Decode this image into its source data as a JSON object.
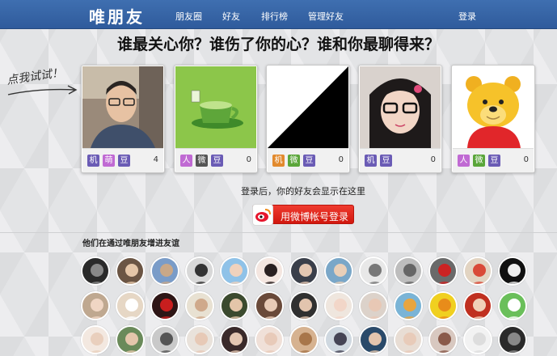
{
  "nav": {
    "brand": "唯朋友",
    "items": [
      "朋友圈",
      "好友",
      "排行榜",
      "管理好友"
    ],
    "login": "登录"
  },
  "headline": "谁最关心你？谁伤了你的心？谁和你最聊得来？",
  "try_it": "点我试试！",
  "cards": [
    {
      "photo": "man-portrait",
      "count": "4"
    },
    {
      "photo": "green-teacup",
      "count": "0"
    },
    {
      "photo": "black-white-diagonal",
      "count": "0"
    },
    {
      "photo": "girl-glasses",
      "count": "0"
    },
    {
      "photo": "winnie-the-pooh",
      "count": "0"
    }
  ],
  "card_badges": {
    "renren": "人",
    "weibo": "微",
    "douban": "豆",
    "mobile": "机",
    "meng": "萌"
  },
  "login_hint": "登录后，你的好友会显示在这里",
  "weibo_button": "用微博帐号登录",
  "section_title": "他们在通过唯朋友增进友谊",
  "colors": {
    "nav_bg": "#2f5b9c",
    "weibo_red": "#d1170e",
    "badge_purple": "#6a5bb5",
    "badge_pink": "#c06ad3",
    "badge_orange": "#e28a2e",
    "badge_green": "#5aa63a"
  }
}
